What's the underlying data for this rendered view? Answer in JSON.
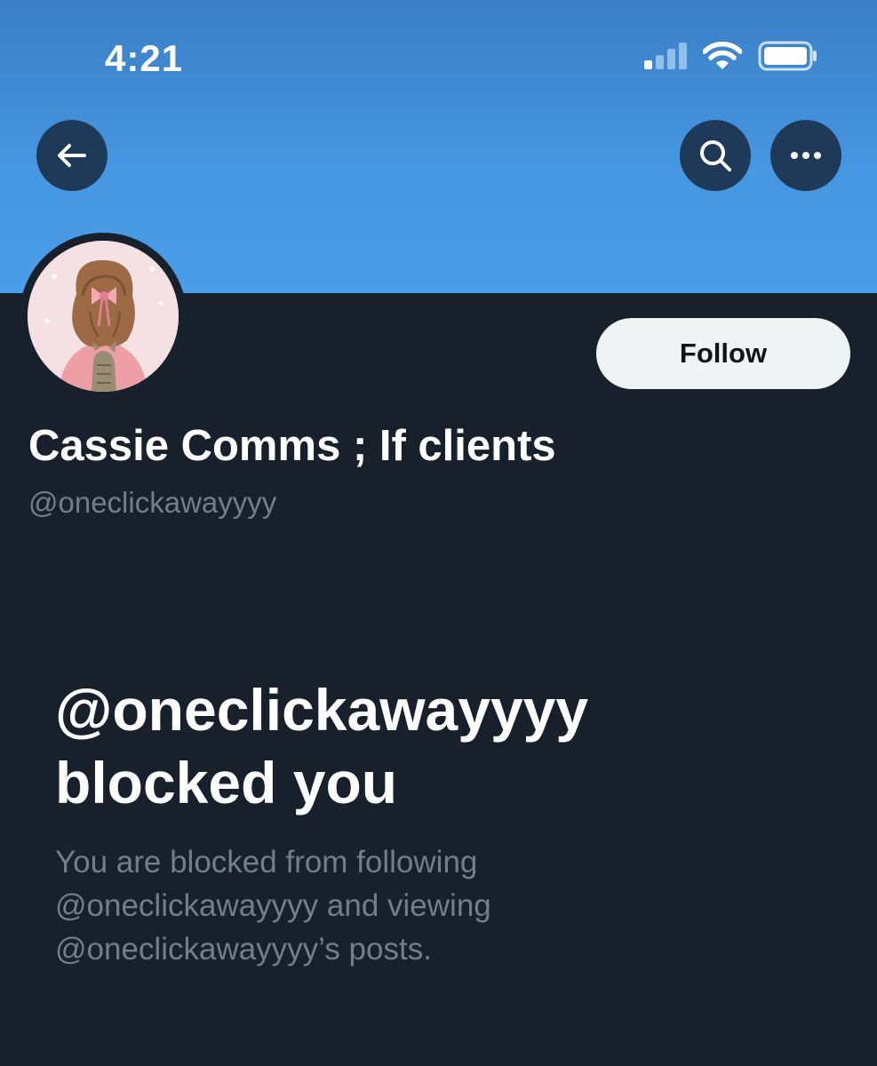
{
  "status_bar": {
    "time": "4:21",
    "icons": [
      "cellular-signal-icon",
      "wifi-icon",
      "battery-icon"
    ]
  },
  "header": {
    "back_icon": "arrow-left-icon",
    "search_icon": "search-icon",
    "more_icon": "more-horizontal-icon"
  },
  "colors": {
    "banner": "#4697e2",
    "background": "#17202b",
    "button_dark": "#1f3a58",
    "follow_bg": "#eff3f4",
    "muted_text": "#717e8b"
  },
  "profile": {
    "display_name": "Cassie Comms ; If clients",
    "handle": "@oneclickawayyyy",
    "follow_label": "Follow"
  },
  "blocked": {
    "title_line1": "@oneclickawayyyy",
    "title_line2": "blocked you",
    "desc_line1": "You are blocked from following",
    "desc_line2": "@oneclickawayyyy and viewing",
    "desc_line3": "@oneclickawayyyy’s posts."
  }
}
